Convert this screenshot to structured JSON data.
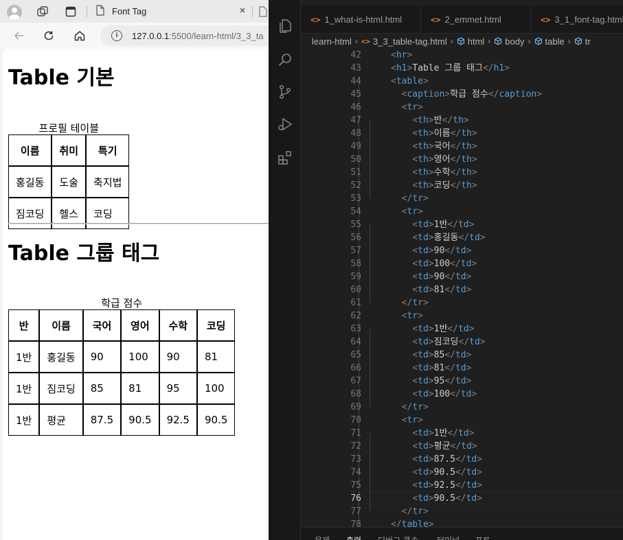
{
  "browser": {
    "tab_title": "Font Tag",
    "url_host": "127.0.0.1",
    "url_path": ":5500/learn-html/3_3_ta"
  },
  "page": {
    "heading1": "Table 기본",
    "table1": {
      "caption": "프로필 테이블",
      "headers": [
        "이름",
        "취미",
        "특기"
      ],
      "rows": [
        [
          "홍길동",
          "도술",
          "축지법"
        ],
        [
          "짐코딩",
          "헬스",
          "코딩"
        ]
      ]
    },
    "heading2": "Table 그룹 태그",
    "table2": {
      "caption": "학급 점수",
      "headers": [
        "반",
        "이름",
        "국어",
        "영어",
        "수학",
        "코딩"
      ],
      "rows": [
        [
          "1반",
          "홍길동",
          "90",
          "100",
          "90",
          "81"
        ],
        [
          "1반",
          "짐코딩",
          "85",
          "81",
          "95",
          "100"
        ],
        [
          "1반",
          "평균",
          "87.5",
          "90.5",
          "92.5",
          "90.5"
        ]
      ]
    }
  },
  "editor": {
    "tabs": [
      "1_what-is-html.html",
      "2_emmet.html",
      "3_1_font-tag.html"
    ],
    "breadcrumb": [
      "learn-html",
      "3_3_table-tag.html",
      "html",
      "body",
      "table",
      "tr"
    ],
    "active_line": 76,
    "first_line": 42,
    "code_lines": [
      "<hr>",
      "<h1>Table 그룹 태그</h1>",
      "<table>",
      "  <caption>학급 점수</caption>",
      "  <tr>",
      "    <th>반</th>",
      "    <th>이름</th>",
      "    <th>국어</th>",
      "    <th>영어</th>",
      "    <th>수학</th>",
      "    <th>코딩</th>",
      "  </tr>",
      "  <tr>",
      "    <td>1반</td>",
      "    <td>홍길동</td>",
      "    <td>90</td>",
      "    <td>100</td>",
      "    <td>90</td>",
      "    <td>81</td>",
      "  </tr>",
      "  <tr>",
      "    <td>1반</td>",
      "    <td>짐코딩</td>",
      "    <td>85</td>",
      "    <td>81</td>",
      "    <td>95</td>",
      "    <td>100</td>",
      "  </tr>",
      "  <tr>",
      "    <td>1반</td>",
      "    <td>평균</td>",
      "    <td>87.5</td>",
      "    <td>90.5</td>",
      "    <td>92.5</td>",
      "    <td>90.5</td>",
      "  </tr>",
      "</table>"
    ],
    "panel_tabs": [
      "문제",
      "출력",
      "디버그 콘솔",
      "터미널",
      "포트"
    ],
    "active_panel_tab": "출력"
  },
  "colors": {
    "tag": "#569cd6",
    "bracket": "#808080",
    "text": "#cccccc",
    "html_icon": "#e37933",
    "editor_bg": "#1f1f1f"
  },
  "icons": {
    "activity_bar": [
      "files-icon",
      "search-icon",
      "source-control-icon",
      "run-debug-icon",
      "extensions-icon"
    ]
  }
}
